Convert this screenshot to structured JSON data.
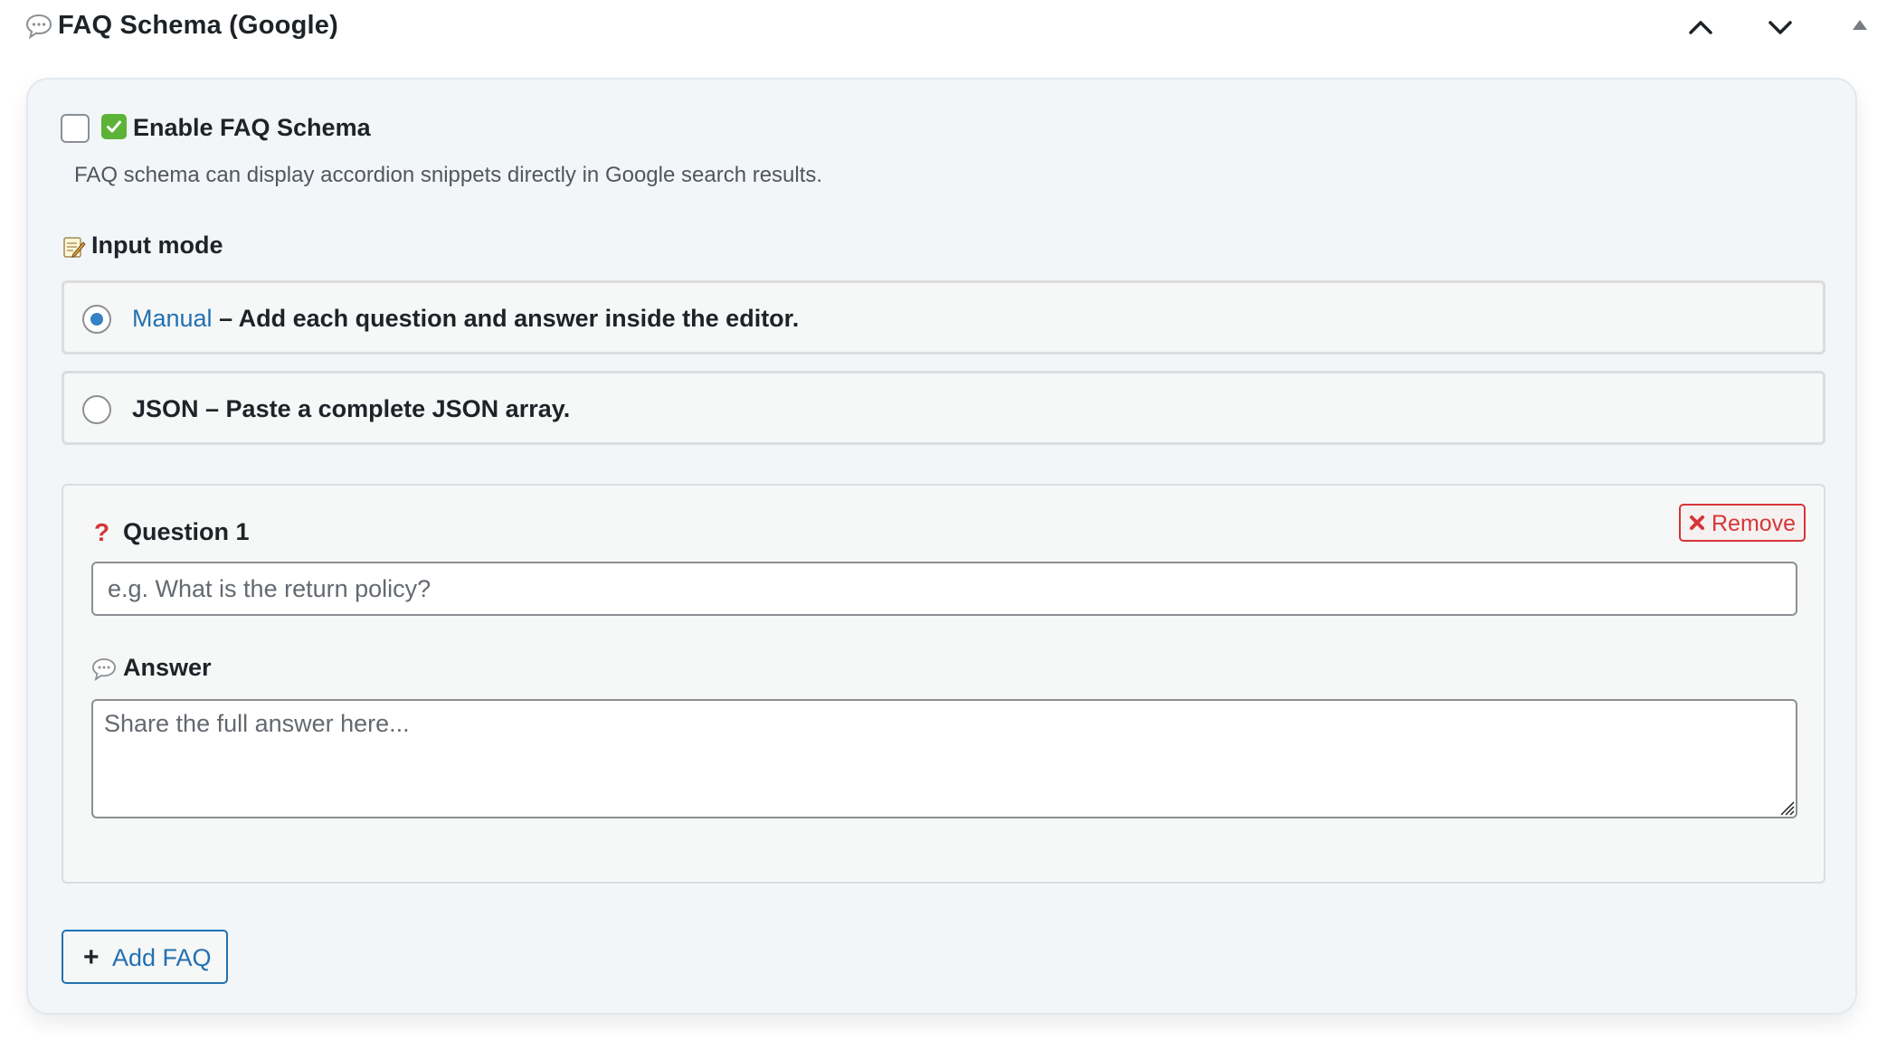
{
  "header": {
    "icon": "speech-bubble-icon",
    "title": "FAQ Schema (Google)",
    "controls": [
      "chevron-up-icon",
      "chevron-down-icon",
      "triangle-up-icon"
    ]
  },
  "enable": {
    "checked": false,
    "emoji": "check-mark-button-icon",
    "label": "Enable FAQ Schema",
    "description": "FAQ schema can display accordion snippets directly in Google search results."
  },
  "input_mode": {
    "icon": "memo-icon",
    "title": "Input mode",
    "options": [
      {
        "name": "Manual",
        "desc": " – Add each question and answer inside the editor.",
        "selected": true
      },
      {
        "name": "JSON",
        "desc": " – Paste a complete JSON array.",
        "selected": false
      }
    ]
  },
  "faq_items": [
    {
      "question_icon": "red-question-mark-icon",
      "question_label": "Question 1",
      "question_placeholder": "e.g. What is the return policy?",
      "question_value": "",
      "answer_icon": "speech-bubble-icon",
      "answer_label": "Answer",
      "answer_placeholder": "Share the full answer here...",
      "answer_value": "",
      "remove_icon": "cross-mark-icon",
      "remove_label": "Remove"
    }
  ],
  "add_button": {
    "icon": "plus-icon",
    "plus": "+",
    "label": "Add FAQ"
  },
  "colors": {
    "accent": "#2271b1",
    "danger": "#d63638",
    "card_bg": "#f3f6f9",
    "emoji_green": "#5cb338"
  }
}
